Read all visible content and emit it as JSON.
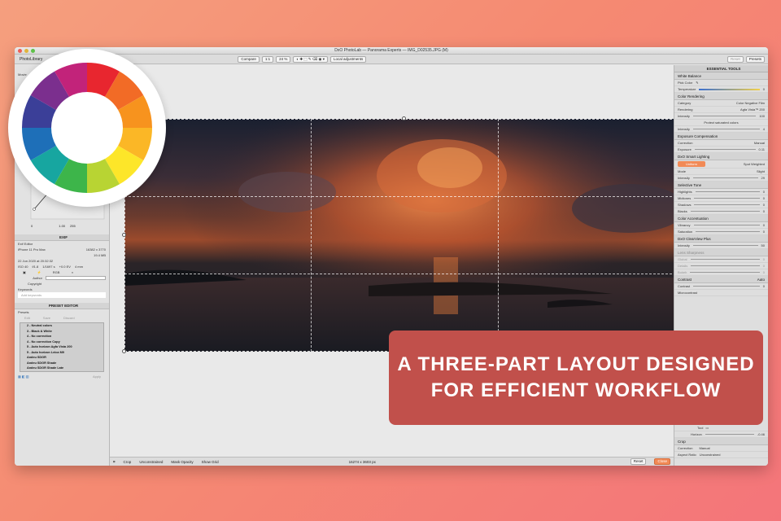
{
  "window": {
    "title": "DxO PhotoLab — Panorama Experts — IMG_D02535.JPG (M)"
  },
  "toolbar": {
    "left_label": "PhotoLibrary",
    "compare_label": "Compare",
    "zoom_ratio": "1:1",
    "zoom_percent": "24 %",
    "local_adjustments_label": "Local adjustments",
    "reset_label": "Reset",
    "presets_label": "Presets"
  },
  "left_panel": {
    "movies_label": "Movie",
    "levels": {
      "val1": "0",
      "val2": "1.00",
      "val3": "255"
    },
    "exif": {
      "section_title": "EXIF",
      "editor_label": "Exif Editor",
      "camera": "iPhone 11 Pro Max",
      "dimensions": "16382 x 3770",
      "file_size": "19.4 MB",
      "date": "22 Jun 2020 at 20:32:32",
      "iso": "ISO 40",
      "aperture": "f/1.8",
      "shutter": "1/1697 s",
      "ev": "+0.0 EV",
      "focal": "4 mm",
      "rgb_label": "RGB",
      "author_label": "Author",
      "copyright_label": "Copyright",
      "keywords_label": "Keywords",
      "keywords_placeholder": "Add keywords"
    },
    "preset_editor": {
      "title": "PRESET EDITOR",
      "presets_label": "Presets",
      "edit_label": "Edit",
      "save_label": "Save",
      "discard_label": "Discard",
      "items": [
        "2 - Neutral colors",
        "3 - Black & White",
        "4 - No correction",
        "4 - No correction Copy",
        "5 - Auto horizon Agfa Vista 200",
        "5 - Auto horizon Leica M9",
        "Andeu SDGR",
        "Andeu SDGR Shade",
        "Andeu SDGR Shade Late"
      ],
      "apply_label": "Apply"
    }
  },
  "right_panel": {
    "header": "ESSENTIAL TOOLS",
    "sections": [
      {
        "title": "White Balance",
        "rows": [
          {
            "label": "Pick Color",
            "value": ""
          },
          {
            "label": "Temperature",
            "value": "0"
          }
        ]
      },
      {
        "title": "Color Rendering",
        "rows": [
          {
            "label": "Category",
            "value": "Color Negative Film"
          },
          {
            "label": "Rendering",
            "value": "Agfa Vista™ 200"
          },
          {
            "label": "Intensity",
            "value": "100"
          },
          {
            "label": "Protect saturated colors",
            "value": ""
          },
          {
            "label": "Intensity",
            "value": "4"
          }
        ]
      },
      {
        "title": "Exposure Compensation",
        "rows": [
          {
            "label": "Correction",
            "value": "Manual"
          },
          {
            "label": "Exposure",
            "value": "0.11"
          }
        ]
      },
      {
        "title": "DxO Smart Lighting",
        "rows": [
          {
            "label": "Uniform",
            "value": "Spot Weighted"
          },
          {
            "label": "Mode",
            "value": "Slight"
          },
          {
            "label": "Intensity",
            "value": "29"
          }
        ]
      },
      {
        "title": "Selective Tone",
        "rows": [
          {
            "label": "Highlights",
            "value": "0"
          },
          {
            "label": "Midtones",
            "value": "0"
          },
          {
            "label": "Shadows",
            "value": "0"
          },
          {
            "label": "Blacks",
            "value": "0"
          }
        ]
      },
      {
        "title": "Color Accentuation",
        "rows": [
          {
            "label": "Vibrancy",
            "value": "0"
          },
          {
            "label": "Saturation",
            "value": "0"
          }
        ]
      },
      {
        "title": "DxO ClearView Plus",
        "rows": [
          {
            "label": "Intensity",
            "value": "50"
          }
        ]
      },
      {
        "title": "Lens Sharpness",
        "rows": [
          {
            "label": "Global",
            "value": "0"
          },
          {
            "label": "Details",
            "value": "0"
          },
          {
            "label": "Bokeh",
            "value": "0"
          }
        ]
      },
      {
        "title": "Contrast",
        "rows": [
          {
            "label": "Contrast",
            "value": "0"
          },
          {
            "label": "Microcontrast",
            "value": ""
          }
        ]
      }
    ],
    "bottom_rows": [
      {
        "label": "Tool",
        "value": ""
      },
      {
        "label": "Horizon",
        "value": "-0.46"
      },
      {
        "label": "Crop",
        "value": ""
      },
      {
        "label": "Correction",
        "value": "Manual"
      },
      {
        "label": "Aspect Ratio",
        "value": "Unconstrained"
      }
    ],
    "contrast_auto": "Auto"
  },
  "bottom_bar": {
    "crop_label": "Crop",
    "constraint": "Unconstrained",
    "mask_opacity": "Mask Opacity",
    "show_grid": "Show Grid",
    "dimensions": "16274 x 3603 px",
    "reset_label": "Reset",
    "close_label": "Close"
  },
  "banner": {
    "line1": "A THREE-PART LAYOUT DESIGNED",
    "line2": "FOR EFFICIENT WORKFLOW"
  },
  "colors": {
    "banner_bg": "#c1504b",
    "accent_orange": "#f28a56",
    "background_start": "#f59f7e",
    "background_end": "#f4757a"
  }
}
